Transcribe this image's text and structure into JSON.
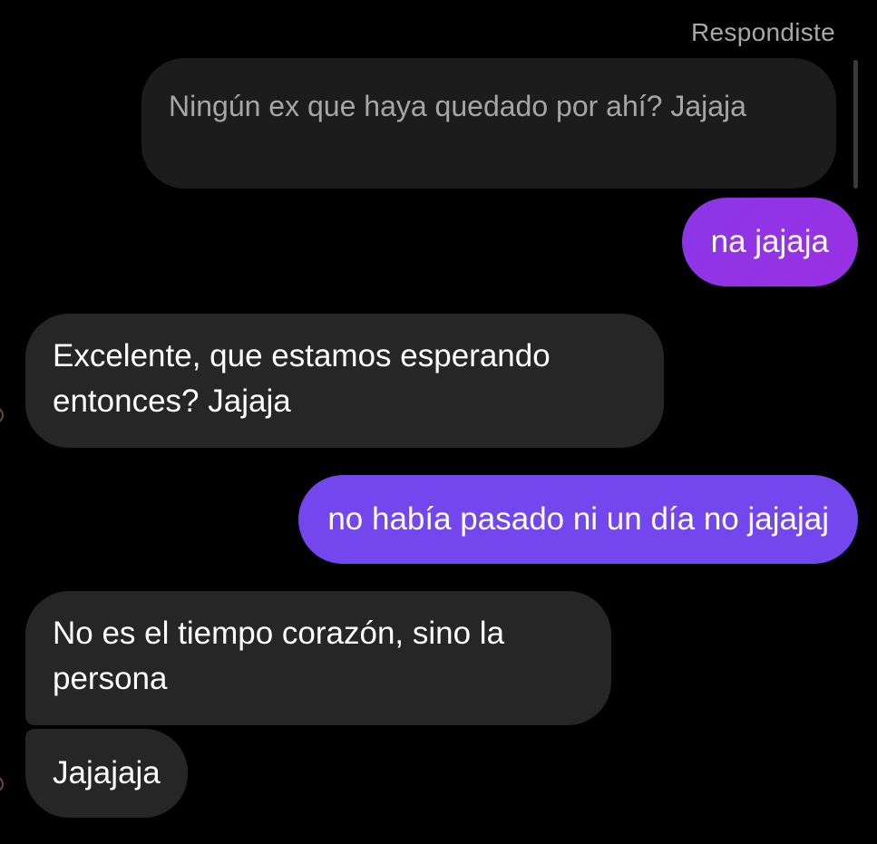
{
  "conversation": {
    "reply_label": "Respondiste",
    "quoted_message": "Ningún ex que haya quedado por ahí? Jajaja",
    "messages": [
      {
        "direction": "outgoing",
        "text": "na jajaja"
      },
      {
        "direction": "incoming",
        "text": "Excelente, que estamos esperando entonces? Jajaja"
      },
      {
        "direction": "outgoing",
        "text": "no había pasado ni un día no jajajaj"
      },
      {
        "direction": "incoming",
        "text": "No es el tiempo corazón, sino la persona"
      },
      {
        "direction": "incoming",
        "text": "Jajajaja"
      }
    ]
  },
  "colors": {
    "background": "#000000",
    "incoming_bubble": "#262626",
    "outgoing_bubble": "#7446ee",
    "outgoing_bubble_alt": "#8a37e6",
    "quoted_bubble": "#1c1c1c",
    "secondary_text": "#a8a8a8"
  }
}
